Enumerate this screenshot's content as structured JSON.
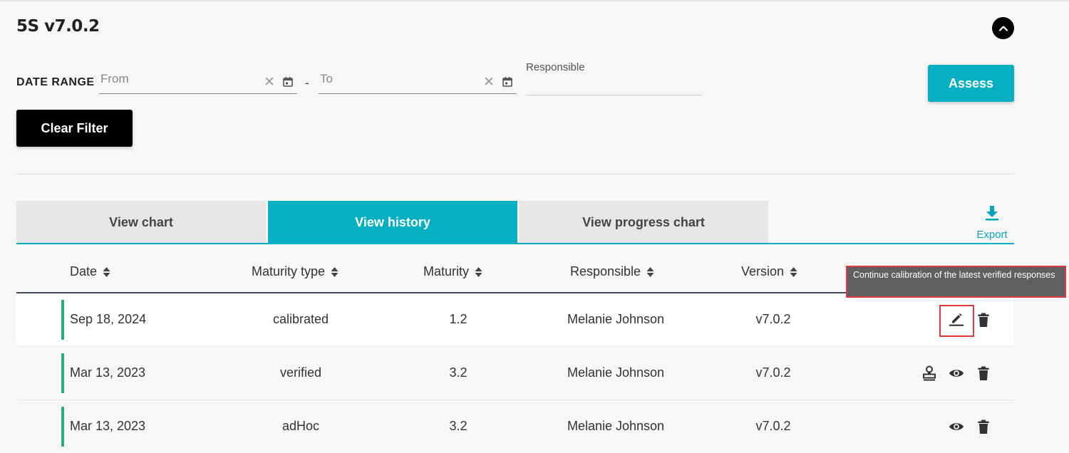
{
  "page": {
    "title": "5S v7.0.2"
  },
  "filters": {
    "date_range_label": "DATE RANGE",
    "from_placeholder": "From",
    "to_placeholder": "To",
    "separator": "-",
    "clear_glyph": "✕",
    "responsible_label": "Responsible",
    "responsible_value": ""
  },
  "buttons": {
    "assess": "Assess",
    "clear_filter": "Clear Filter"
  },
  "tabs": [
    {
      "label": "View chart",
      "active": false
    },
    {
      "label": "View history",
      "active": true
    },
    {
      "label": "View progress chart",
      "active": false
    }
  ],
  "export": {
    "label": "Export",
    "icon": "download-icon"
  },
  "table": {
    "columns": [
      "Date",
      "Maturity type",
      "Maturity",
      "Responsible",
      "Version"
    ],
    "rows": [
      {
        "date": "Sep 18, 2024",
        "maturity_type": "calibrated",
        "maturity": "1.2",
        "responsible": "Melanie Johnson",
        "version": "v7.0.2",
        "actions": [
          "edit-icon",
          "trash-icon"
        ]
      },
      {
        "date": "Mar 13, 2023",
        "maturity_type": "verified",
        "maturity": "3.2",
        "responsible": "Melanie Johnson",
        "version": "v7.0.2",
        "actions": [
          "stamp-icon",
          "eye-icon",
          "trash-icon"
        ]
      },
      {
        "date": "Mar 13, 2023",
        "maturity_type": "adHoc",
        "maturity": "3.2",
        "responsible": "Melanie Johnson",
        "version": "v7.0.2",
        "actions": [
          "eye-icon",
          "trash-icon"
        ]
      }
    ]
  },
  "tooltip": {
    "text": "Continue calibration of the latest verified responses"
  },
  "colors": {
    "accent": "#06b0c2",
    "status_bar": "#2eaa7b",
    "highlight": "#e0393e",
    "tooltip_bg": "#5f5f5f"
  }
}
